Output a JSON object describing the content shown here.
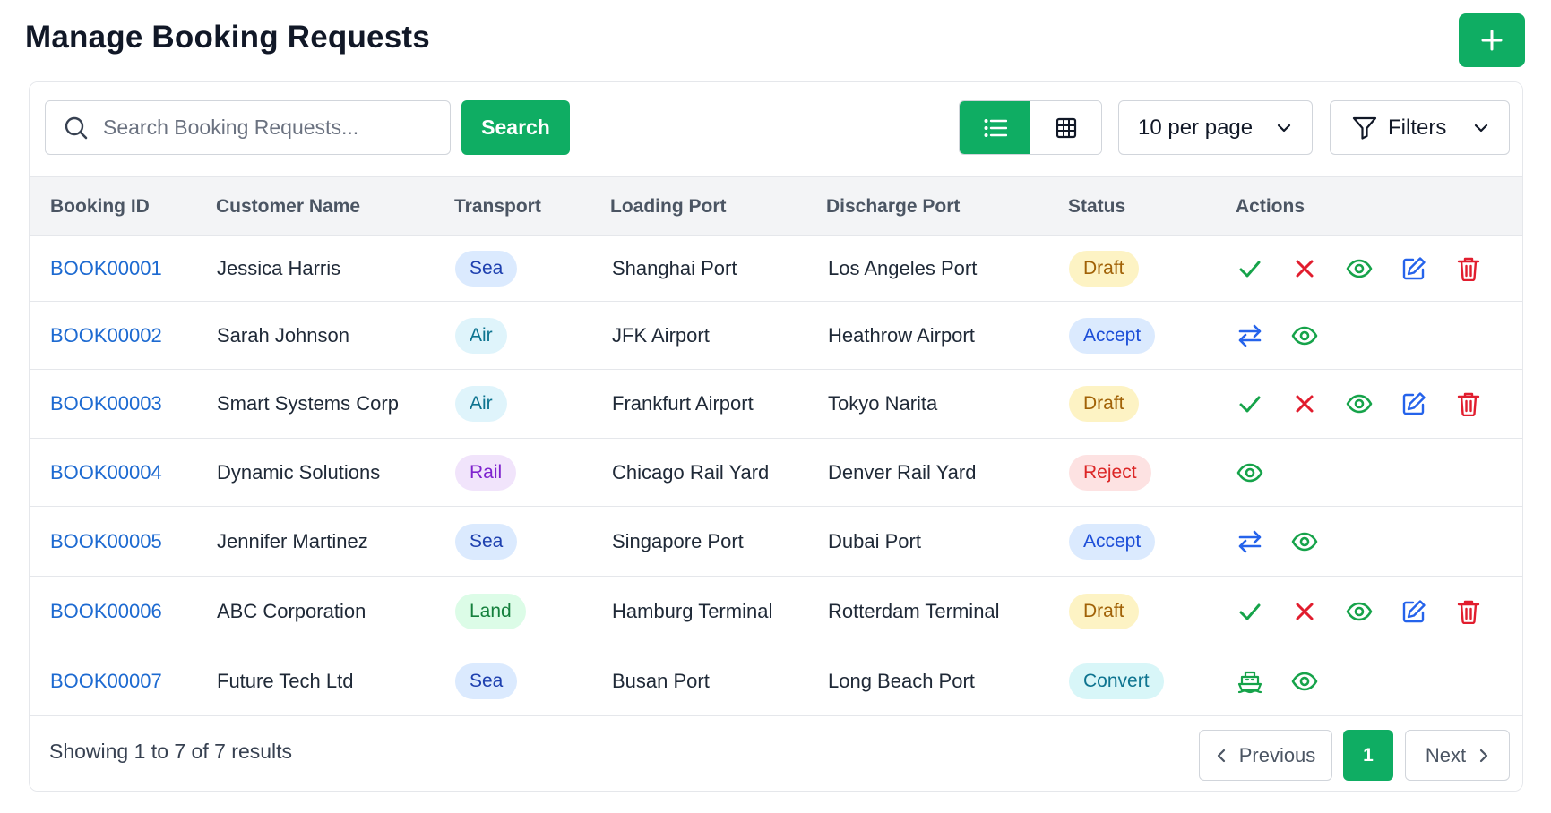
{
  "header": {
    "title": "Manage Booking Requests",
    "add_icon": "plus-icon"
  },
  "toolbar": {
    "search_placeholder": "Search Booking Requests...",
    "search_value": "",
    "search_label": "Search",
    "view_modes": [
      "list-icon",
      "grid-icon"
    ],
    "active_view": "list",
    "per_page": "10 per page",
    "filters_label": "Filters"
  },
  "table": {
    "columns": [
      "Booking ID",
      "Customer Name",
      "Transport",
      "Loading Port",
      "Discharge Port",
      "Status",
      "Actions"
    ],
    "rows": [
      {
        "id": "BOOK00001",
        "customer": "Jessica Harris",
        "transport": "Sea",
        "loading": "Shanghai Port",
        "discharge": "Los Angeles Port",
        "status": "Draft",
        "actions": [
          "check-icon",
          "close-icon",
          "eye-icon",
          "edit-icon",
          "trash-icon"
        ]
      },
      {
        "id": "BOOK00002",
        "customer": "Sarah Johnson",
        "transport": "Air",
        "loading": "JFK Airport",
        "discharge": "Heathrow Airport",
        "status": "Accept",
        "actions": [
          "transfer-icon",
          "eye-icon"
        ]
      },
      {
        "id": "BOOK00003",
        "customer": "Smart Systems Corp",
        "transport": "Air",
        "loading": "Frankfurt Airport",
        "discharge": "Tokyo Narita",
        "status": "Draft",
        "actions": [
          "check-icon",
          "close-icon",
          "eye-icon",
          "edit-icon",
          "trash-icon"
        ]
      },
      {
        "id": "BOOK00004",
        "customer": "Dynamic Solutions",
        "transport": "Rail",
        "loading": "Chicago Rail Yard",
        "discharge": "Denver Rail Yard",
        "status": "Reject",
        "actions": [
          "eye-icon"
        ]
      },
      {
        "id": "BOOK00005",
        "customer": "Jennifer Martinez",
        "transport": "Sea",
        "loading": "Singapore Port",
        "discharge": "Dubai Port",
        "status": "Accept",
        "actions": [
          "transfer-icon",
          "eye-icon"
        ]
      },
      {
        "id": "BOOK00006",
        "customer": "ABC Corporation",
        "transport": "Land",
        "loading": "Hamburg Terminal",
        "discharge": "Rotterdam Terminal",
        "status": "Draft",
        "actions": [
          "check-icon",
          "close-icon",
          "eye-icon",
          "edit-icon",
          "trash-icon"
        ]
      },
      {
        "id": "BOOK00007",
        "customer": "Future Tech Ltd",
        "transport": "Sea",
        "loading": "Busan Port",
        "discharge": "Long Beach Port",
        "status": "Convert",
        "actions": [
          "ship-icon",
          "eye-icon"
        ]
      }
    ]
  },
  "pagination": {
    "summary": "Showing 1 to 7 of 7 results",
    "previous_label": "Previous",
    "current_page": "1",
    "next_label": "Next"
  },
  "colors": {
    "brand_green": "#0fad63",
    "link_blue": "#1d6ad1",
    "transport": {
      "Sea": {
        "bg": "#dbeafe",
        "fg": "#1e40af"
      },
      "Air": {
        "bg": "#dff4fb",
        "fg": "#0e7490"
      },
      "Rail": {
        "bg": "#f1e4fb",
        "fg": "#7e22ce"
      },
      "Land": {
        "bg": "#dcfce7",
        "fg": "#15803d"
      }
    },
    "status": {
      "Draft": {
        "bg": "#fdf3c4",
        "fg": "#a16207"
      },
      "Accept": {
        "bg": "#dbeafe",
        "fg": "#1d4ed8"
      },
      "Reject": {
        "bg": "#fde2e2",
        "fg": "#dc2626"
      },
      "Convert": {
        "bg": "#d8f6f8",
        "fg": "#0e7490"
      }
    },
    "actions": {
      "check-icon": "#16a34a",
      "close-icon": "#e11d2e",
      "eye-icon": "#16a34a",
      "edit-icon": "#2563eb",
      "trash-icon": "#e11d2e",
      "transfer-icon": "#2563eb",
      "ship-icon": "#16a34a"
    }
  }
}
